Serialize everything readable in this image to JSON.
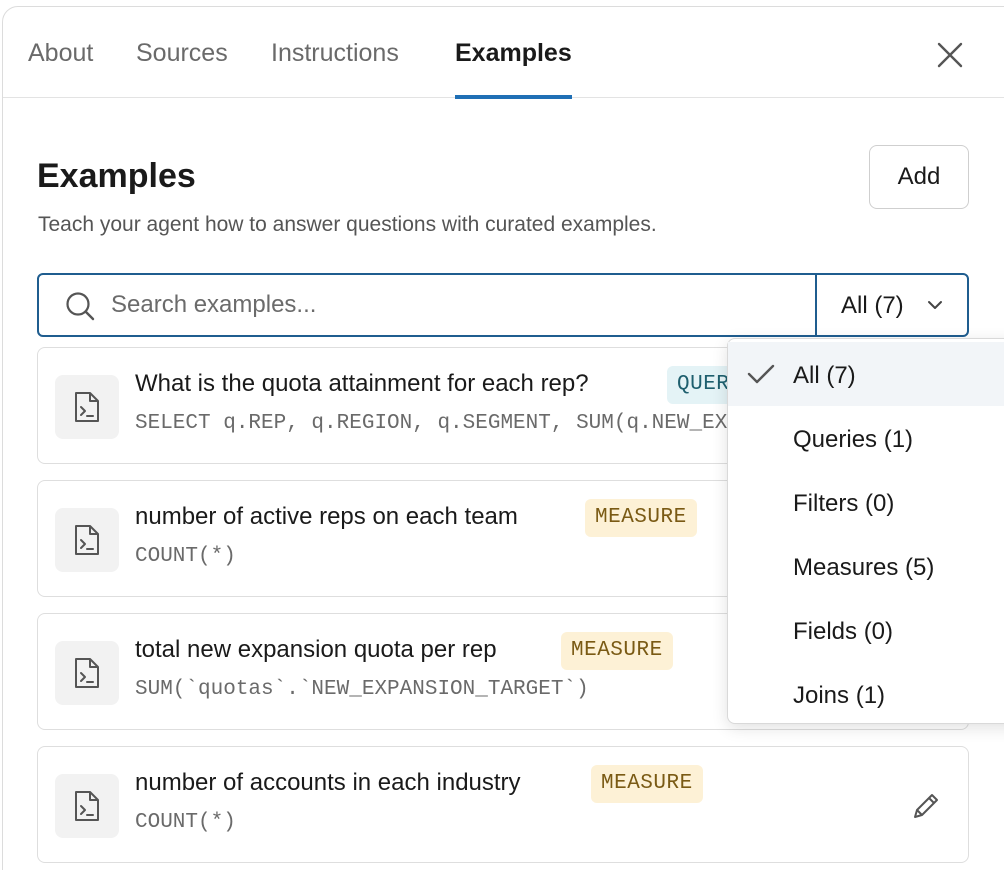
{
  "tabs": [
    {
      "label": "About"
    },
    {
      "label": "Sources"
    },
    {
      "label": "Instructions"
    },
    {
      "label": "Examples"
    }
  ],
  "header": {
    "title": "Examples",
    "subtitle": "Teach your agent how to answer questions with curated examples.",
    "add_label": "Add"
  },
  "search": {
    "placeholder": "Search examples...",
    "value": ""
  },
  "filter": {
    "selected_label": "All (7)",
    "options": [
      {
        "label": "All (7)"
      },
      {
        "label": "Queries (1)"
      },
      {
        "label": "Filters (0)"
      },
      {
        "label": "Measures (5)"
      },
      {
        "label": "Fields (0)"
      },
      {
        "label": "Joins (1)"
      }
    ]
  },
  "examples": [
    {
      "title": "What is the quota attainment for each rep?",
      "badge": "QUERY",
      "code": "SELECT q.REP, q.REGION, q.SEGMENT, SUM(q.NEW_EXPANSION_TARGET)"
    },
    {
      "title": "number of active reps on each team",
      "badge": "MEASURE",
      "code": "COUNT(*)"
    },
    {
      "title": "total new expansion quota per rep",
      "badge": "MEASURE",
      "code": "SUM(`quotas`.`NEW_EXPANSION_TARGET`)"
    },
    {
      "title": "number of accounts in each industry",
      "badge": "MEASURE",
      "code": "COUNT(*)"
    }
  ],
  "colors": {
    "accent": "#1f6fb5",
    "search_border": "#1f5d8f",
    "measure_badge_bg": "#fdf1d6",
    "query_badge_bg": "#e4f3f6"
  },
  "icons": {
    "close": "close-icon",
    "search": "search-icon",
    "chevron": "chevron-down-icon",
    "card": "terminal-file-icon",
    "edit": "pencil-icon",
    "check": "check-icon"
  }
}
